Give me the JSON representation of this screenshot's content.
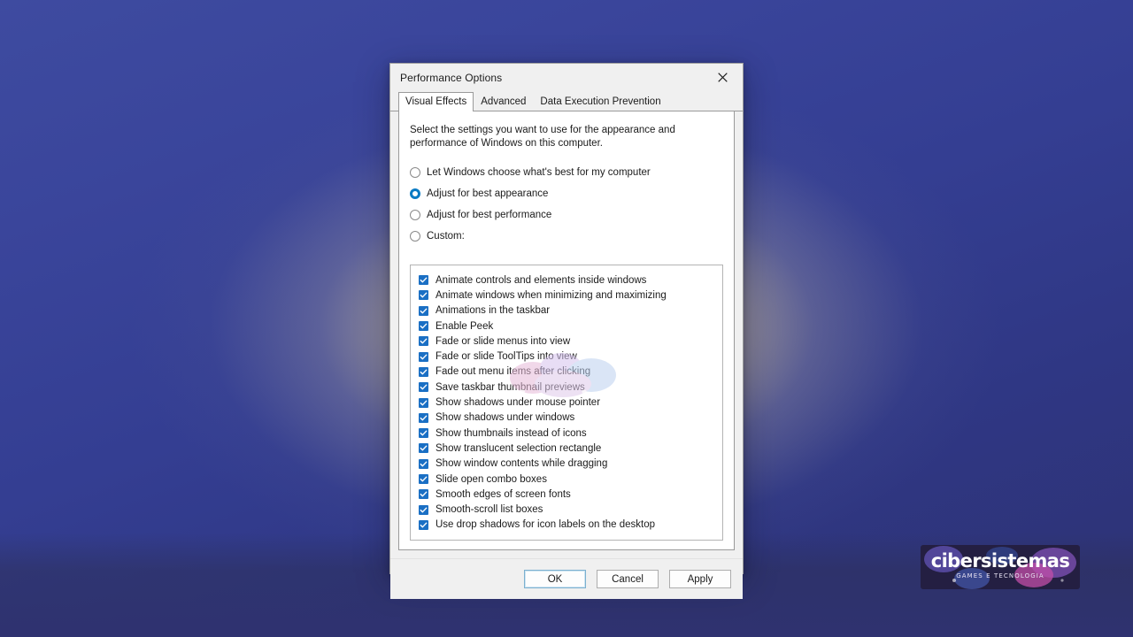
{
  "window": {
    "title": "Performance Options",
    "close_icon": "close-icon"
  },
  "tabs": [
    {
      "label": "Visual Effects",
      "active": true
    },
    {
      "label": "Advanced",
      "active": false
    },
    {
      "label": "Data Execution Prevention",
      "active": false
    }
  ],
  "pane": {
    "intro": "Select the settings you want to use for the appearance and performance of Windows on this computer.",
    "radios": [
      {
        "label": "Let Windows choose what's best for my computer",
        "checked": false
      },
      {
        "label": "Adjust for best appearance",
        "checked": true
      },
      {
        "label": "Adjust for best performance",
        "checked": false
      },
      {
        "label": "Custom:",
        "checked": false
      }
    ],
    "effects": [
      {
        "label": "Animate controls and elements inside windows",
        "checked": true
      },
      {
        "label": "Animate windows when minimizing and maximizing",
        "checked": true
      },
      {
        "label": "Animations in the taskbar",
        "checked": true
      },
      {
        "label": "Enable Peek",
        "checked": true
      },
      {
        "label": "Fade or slide menus into view",
        "checked": true
      },
      {
        "label": "Fade or slide ToolTips into view",
        "checked": true
      },
      {
        "label": "Fade out menu items after clicking",
        "checked": true
      },
      {
        "label": "Save taskbar thumbnail previews",
        "checked": true
      },
      {
        "label": "Show shadows under mouse pointer",
        "checked": true
      },
      {
        "label": "Show shadows under windows",
        "checked": true
      },
      {
        "label": "Show thumbnails instead of icons",
        "checked": true
      },
      {
        "label": "Show translucent selection rectangle",
        "checked": true
      },
      {
        "label": "Show window contents while dragging",
        "checked": true
      },
      {
        "label": "Slide open combo boxes",
        "checked": true
      },
      {
        "label": "Smooth edges of screen fonts",
        "checked": true
      },
      {
        "label": "Smooth-scroll list boxes",
        "checked": true
      },
      {
        "label": "Use drop shadows for icon labels on the desktop",
        "checked": true
      }
    ]
  },
  "footer": {
    "ok": "OK",
    "cancel": "Cancel",
    "apply": "Apply"
  },
  "watermark": {
    "name": "cibersistemas",
    "tagline": "GAMES E TECNOLOGIA"
  },
  "colors": {
    "accent": "#1a6fc4",
    "radio_accent": "#0a7bc4",
    "dialog_bg": "#f0f0f0",
    "pane_bg": "#ffffff",
    "wallpaper_blue": "#3a459b",
    "wallpaper_glow": "#f0e0aa"
  }
}
